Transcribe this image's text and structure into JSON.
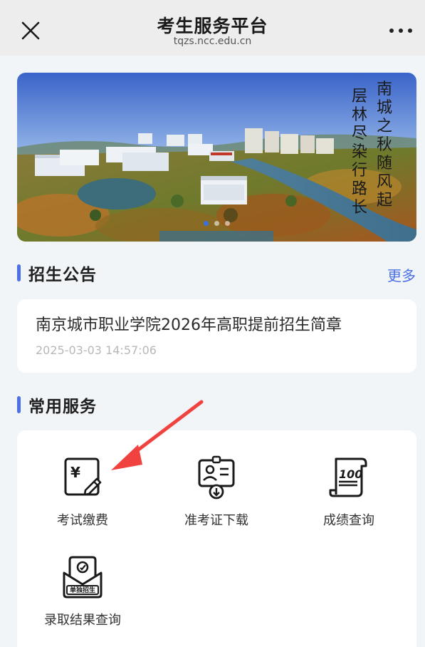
{
  "header": {
    "title": "考生服务平台",
    "url": "tqzs.ncc.edu.cn",
    "close_icon": "close-icon",
    "more_icon": "more-dots-icon"
  },
  "banner": {
    "calligraphy_line1": "南城之秋随风起",
    "calligraphy_line2": "层林尽染行路长",
    "dot_count": 3,
    "active_dot": 1
  },
  "notices": {
    "section_title": "招生公告",
    "more_label": "更多",
    "items": [
      {
        "title": "南京城市职业学院2026年高职提前招生简章",
        "time": "2025-03-03 14:57:06"
      }
    ]
  },
  "services": {
    "section_title": "常用服务",
    "items": [
      {
        "label": "考试缴费",
        "icon": "payment-icon"
      },
      {
        "label": "准考证下载",
        "icon": "admission-ticket-download-icon"
      },
      {
        "label": "成绩查询",
        "icon": "score-icon"
      },
      {
        "label": "录取结果查询",
        "icon": "admission-result-icon",
        "badge": "单独招生"
      }
    ]
  },
  "colors": {
    "accent": "#4d6fe8",
    "link": "#4a6fe6",
    "arrow": "#f0433f"
  }
}
